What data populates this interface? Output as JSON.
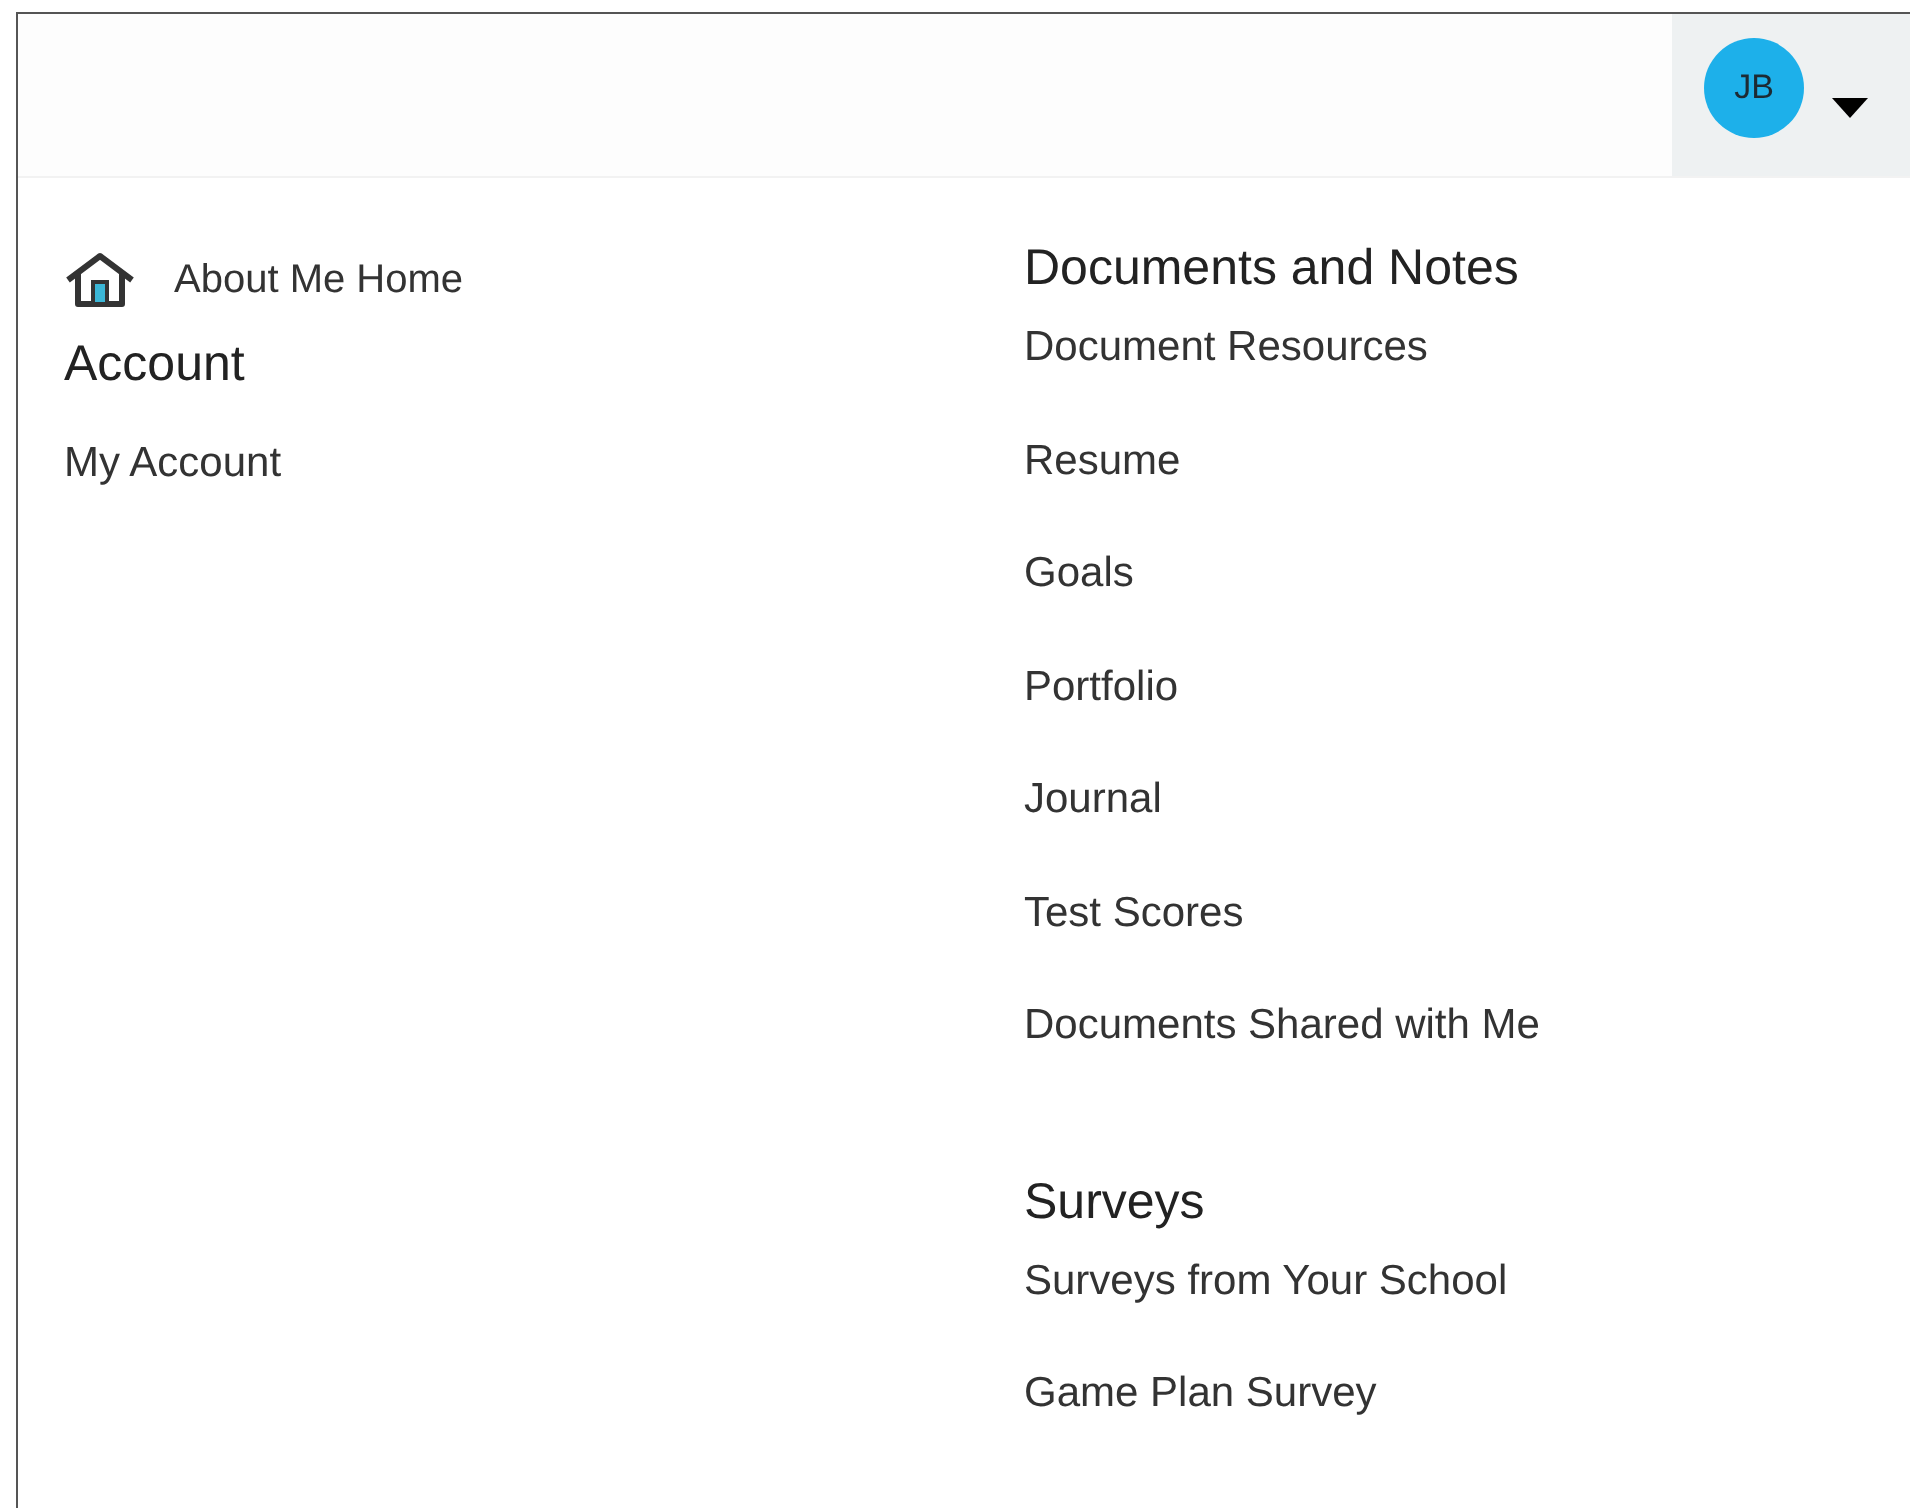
{
  "user": {
    "initials": "JB"
  },
  "home_link": "About Me Home",
  "left_column": [
    {
      "title": "Account",
      "links": [
        "My Account"
      ]
    }
  ],
  "right_column": [
    {
      "title": "Documents and Notes",
      "links": [
        "Document Resources",
        "Resume",
        "Goals",
        "Portfolio",
        "Journal",
        "Test Scores",
        "Documents Shared with Me"
      ]
    },
    {
      "title": "Surveys",
      "links": [
        "Surveys from Your School",
        "Game Plan Survey"
      ]
    }
  ]
}
